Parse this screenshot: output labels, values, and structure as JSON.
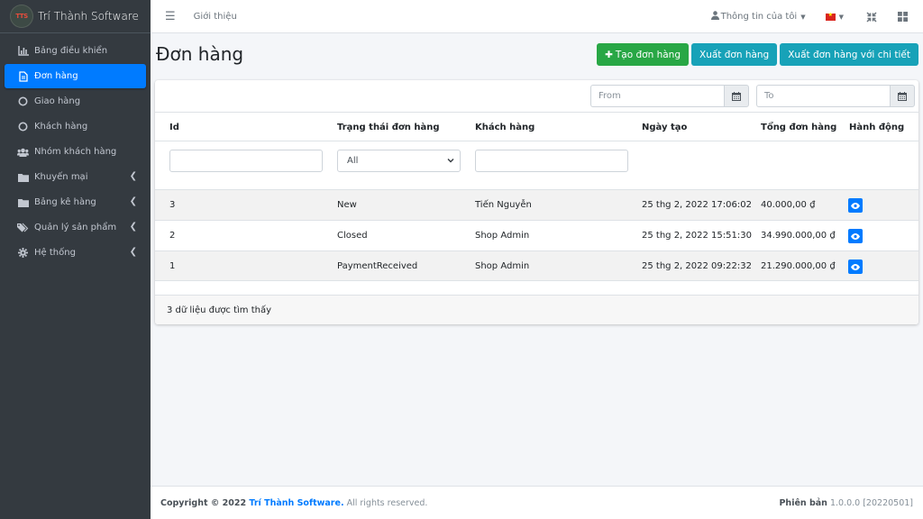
{
  "brand": {
    "name": "Trí Thành Software",
    "logo_text": "TTS"
  },
  "sidebar": {
    "items": [
      {
        "label": "Bảng điều khiển",
        "icon": "chart-bar-icon",
        "active": false,
        "has_arrow": false
      },
      {
        "label": "Đơn hàng",
        "icon": "file-icon",
        "active": true,
        "has_arrow": false
      },
      {
        "label": "Giao hàng",
        "icon": "circle-icon",
        "active": false,
        "has_arrow": false
      },
      {
        "label": "Khách hàng",
        "icon": "circle-icon",
        "active": false,
        "has_arrow": false
      },
      {
        "label": "Nhóm khách hàng",
        "icon": "users-icon",
        "active": false,
        "has_arrow": false
      },
      {
        "label": "Khuyến mại",
        "icon": "folder-icon",
        "active": false,
        "has_arrow": true
      },
      {
        "label": "Bảng kê hàng",
        "icon": "folder-icon",
        "active": false,
        "has_arrow": true
      },
      {
        "label": "Quản lý sản phẩm",
        "icon": "tags-icon",
        "active": false,
        "has_arrow": true
      },
      {
        "label": "Hệ thống",
        "icon": "gear-icon",
        "active": false,
        "has_arrow": true
      }
    ]
  },
  "topnav": {
    "about_link": "Giới thiệu",
    "user_menu": "Thông tin của tôi"
  },
  "page": {
    "title": "Đơn hàng",
    "buttons": {
      "create": "Tạo đơn hàng",
      "export": "Xuất đơn hàng",
      "export_detail": "Xuất đơn hàng với chi tiết"
    },
    "date_filter": {
      "from_placeholder": "From",
      "to_placeholder": "To"
    }
  },
  "table": {
    "headers": [
      "Id",
      "Trạng thái đơn hàng",
      "Khách hàng",
      "Ngày tạo",
      "Tổng đơn hàng",
      "Hành động"
    ],
    "status_filter_value": "All",
    "rows": [
      {
        "id": "3",
        "status": "New",
        "customer": "Tiến Nguyễn",
        "created": "25 thg 2, 2022 17:06:02",
        "total": "40.000,00 ₫"
      },
      {
        "id": "2",
        "status": "Closed",
        "customer": "Shop Admin",
        "created": "25 thg 2, 2022 15:51:30",
        "total": "34.990.000,00 ₫"
      },
      {
        "id": "1",
        "status": "PaymentReceived",
        "customer": "Shop Admin",
        "created": "25 thg 2, 2022 09:22:32",
        "total": "21.290.000,00 ₫"
      }
    ],
    "result_count": "3 dữ liệu được tìm thấy"
  },
  "footer": {
    "copyright_prefix": "Copyright © 2022 ",
    "company": "Trí Thành Software.",
    "rights": " All rights reserved.",
    "version_label": "Phiên bản",
    "version_value": " 1.0.0.0 [20220501]"
  },
  "colors": {
    "sidebar_bg": "#343a40",
    "active": "#007bff",
    "success": "#28a745",
    "info": "#17a2b8"
  }
}
